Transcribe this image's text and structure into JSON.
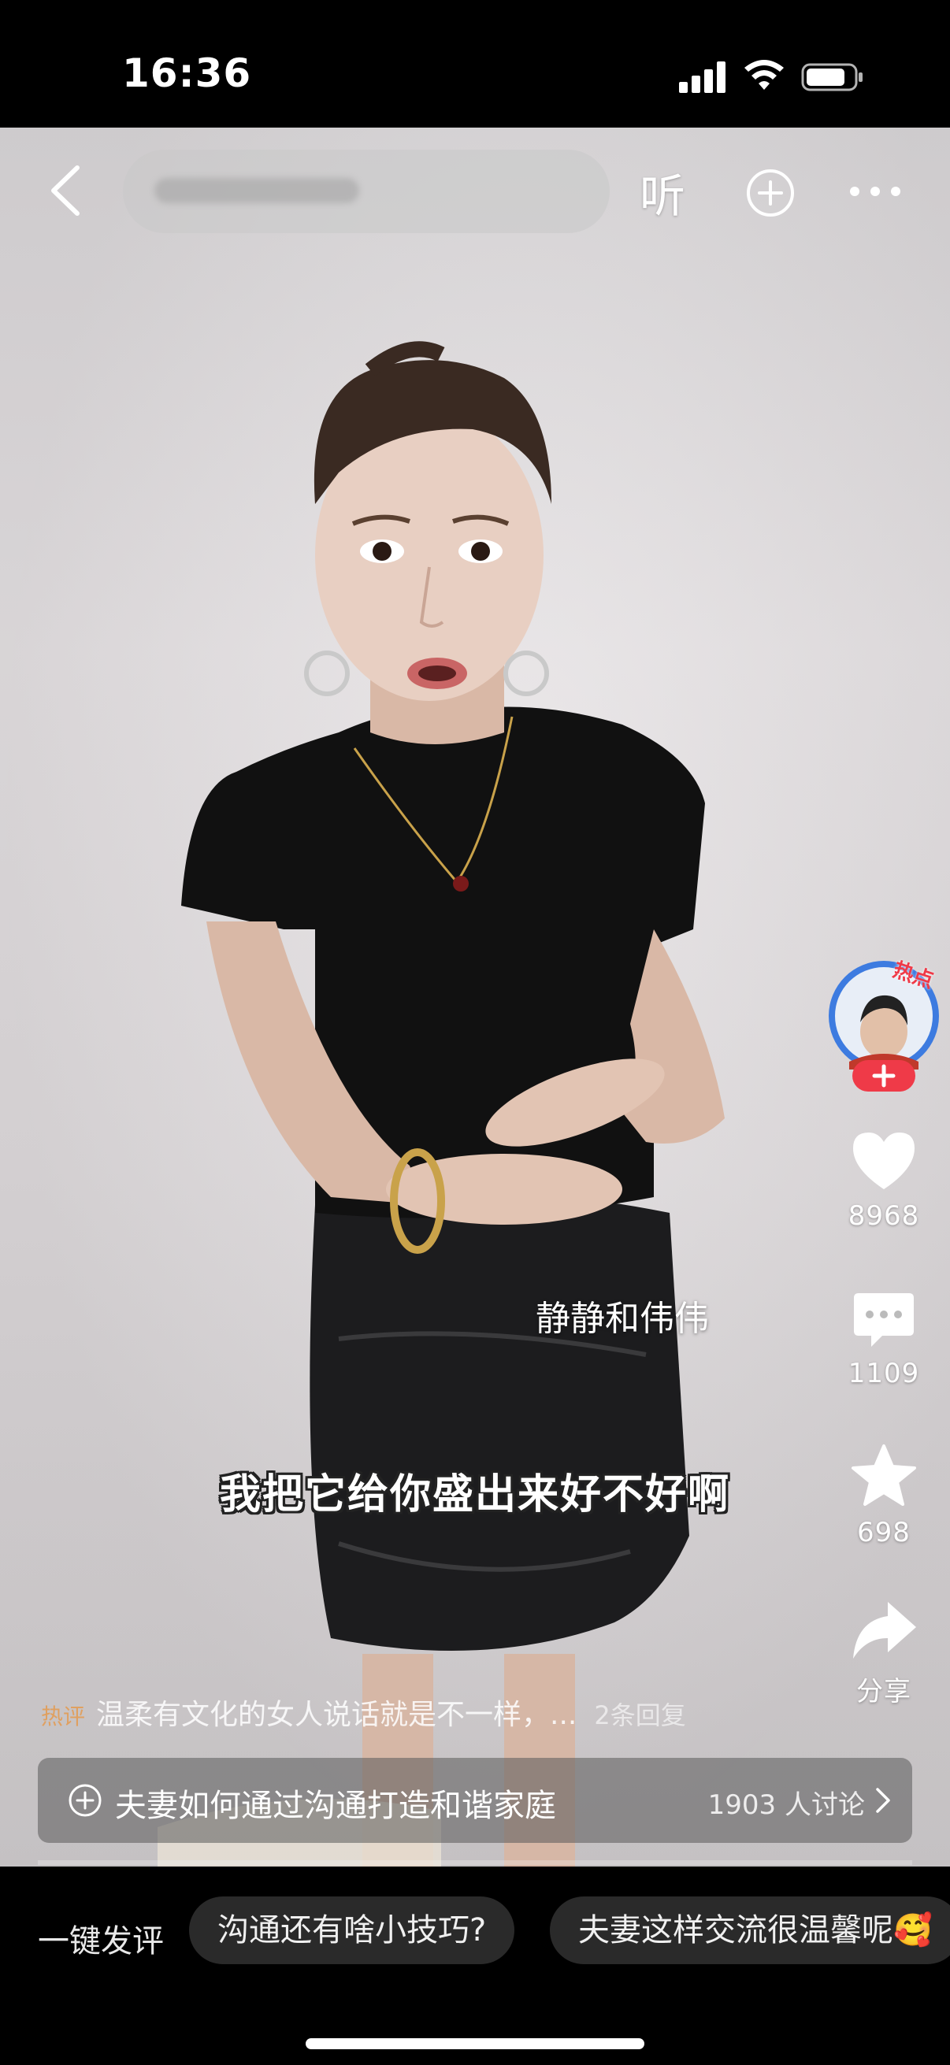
{
  "status": {
    "time": "16:36"
  },
  "nav": {
    "listen_label": "听",
    "back_icon": "chevron-left-icon",
    "add_icon": "plus-circle-icon",
    "more_icon": "more-dots-icon"
  },
  "rail": {
    "avatar_badge": "热点",
    "likes": "8968",
    "comments": "1109",
    "favorites": "698",
    "share_label": "分享"
  },
  "video": {
    "watermark": "静静和伟伟",
    "subtitle": "我把它给你盛出来好不好啊"
  },
  "hot_comment": {
    "tag": "热评",
    "text": "温柔有文化的女人说话就是不一样，...",
    "replies": "2条回复"
  },
  "topic": {
    "text": "夫妻如何通过沟通打造和谐家庭",
    "count": "1903 人讨论"
  },
  "quick_comments": {
    "label": "一键发评",
    "chips": [
      "沟通还有啥小技巧?",
      "夫妻这样交流很温馨呢🥰"
    ]
  },
  "colors": {
    "accent_red": "#ef3a48",
    "avatar_ring": "#3d7be0"
  }
}
